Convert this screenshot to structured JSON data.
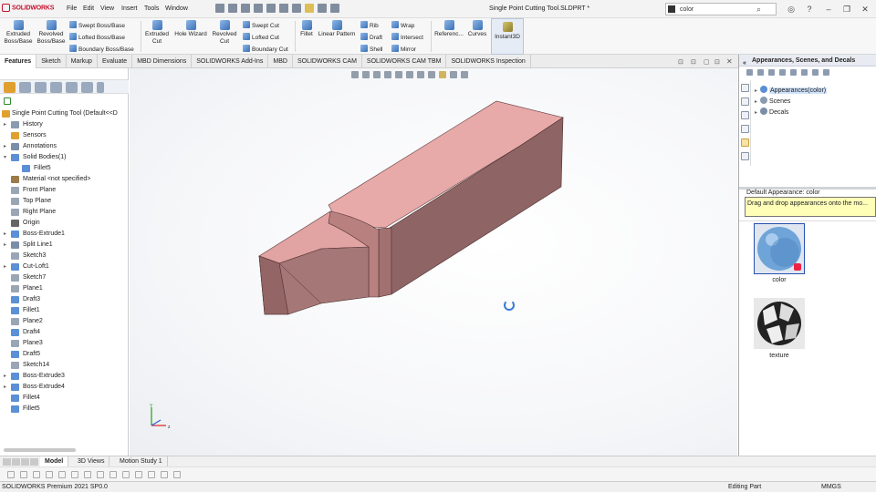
{
  "app": {
    "logo_text": "SOLIDWORKS",
    "menus": [
      "File",
      "Edit",
      "View",
      "Insert",
      "Tools",
      "Window"
    ],
    "document_title": "Single Point Cutting Tool.SLDPRT *",
    "search_value": "color",
    "search_icon": "magnifier-icon",
    "window_buttons": [
      "?",
      "–",
      "❐",
      "✕"
    ]
  },
  "ribbon": {
    "extruded_boss": "Extruded\nBoss/Base",
    "revolved_boss": "Revolved\nBoss/Base",
    "swept_boss": "Swept Boss/Base",
    "lofted_boss": "Lofted Boss/Base",
    "boundary_boss": "Boundary Boss/Base",
    "extruded_cut": "Extruded\nCut",
    "hole_wizard": "Hole Wizard",
    "revolved_cut": "Revolved\nCut",
    "swept_cut": "Swept Cut",
    "lofted_cut": "Lofted Cut",
    "boundary_cut": "Boundary Cut",
    "fillet": "Fillet",
    "linear_pattern": "Linear Pattern",
    "rib": "Rib",
    "draft": "Draft",
    "shell": "Shell",
    "wrap": "Wrap",
    "intersect": "Intersect",
    "mirror": "Mirror",
    "reference": "Referenc...",
    "curves": "Curves",
    "instant3d": "Instant3D"
  },
  "cm_tabs": [
    "Features",
    "Sketch",
    "Markup",
    "Evaluate",
    "MBD Dimensions",
    "SOLIDWORKS Add-Ins",
    "MBD",
    "SOLIDWORKS CAM",
    "SOLIDWORKS CAM TBM",
    "SOLIDWORKS Inspection"
  ],
  "feature_tree": {
    "root": "Single Point Cutting Tool  (Default<<D",
    "items": [
      {
        "label": "History",
        "arrow": "▸",
        "icon_color": "#8a9bb0"
      },
      {
        "label": "Sensors",
        "arrow": "",
        "icon_color": "#e0a030"
      },
      {
        "label": "Annotations",
        "arrow": "▸",
        "icon_color": "#7a8ea8"
      },
      {
        "label": "Solid Bodies(1)",
        "arrow": "▾",
        "icon_color": "#5b8fd6"
      },
      {
        "label": "Fillet5",
        "arrow": "",
        "icon_color": "#5b8fd6",
        "indent": 1
      },
      {
        "label": "Material <not specified>",
        "arrow": "",
        "icon_color": "#9c7a4a"
      },
      {
        "label": "Front Plane",
        "arrow": "",
        "icon_color": "#9aa6b5"
      },
      {
        "label": "Top Plane",
        "arrow": "",
        "icon_color": "#9aa6b5"
      },
      {
        "label": "Right Plane",
        "arrow": "",
        "icon_color": "#9aa6b5"
      },
      {
        "label": "Origin",
        "arrow": "",
        "icon_color": "#666666"
      },
      {
        "label": "Boss-Extrude1",
        "arrow": "▸",
        "icon_color": "#5b8fd6"
      },
      {
        "label": "Split Line1",
        "arrow": "▸",
        "icon_color": "#7a8ea8"
      },
      {
        "label": "Sketch3",
        "arrow": "",
        "icon_color": "#9aa6b5"
      },
      {
        "label": "Cut-Loft1",
        "arrow": "▸",
        "icon_color": "#5b8fd6"
      },
      {
        "label": "Sketch7",
        "arrow": "",
        "icon_color": "#9aa6b5"
      },
      {
        "label": "Plane1",
        "arrow": "",
        "icon_color": "#9aa6b5"
      },
      {
        "label": "Draft3",
        "arrow": "",
        "icon_color": "#5b8fd6"
      },
      {
        "label": "Fillet1",
        "arrow": "",
        "icon_color": "#5b8fd6"
      },
      {
        "label": "Plane2",
        "arrow": "",
        "icon_color": "#9aa6b5"
      },
      {
        "label": "Draft4",
        "arrow": "",
        "icon_color": "#5b8fd6"
      },
      {
        "label": "Plane3",
        "arrow": "",
        "icon_color": "#9aa6b5"
      },
      {
        "label": "Draft5",
        "arrow": "",
        "icon_color": "#5b8fd6"
      },
      {
        "label": "Sketch14",
        "arrow": "",
        "icon_color": "#9aa6b5"
      },
      {
        "label": "Boss-Extrude3",
        "arrow": "▸",
        "icon_color": "#5b8fd6"
      },
      {
        "label": "Boss-Extrude4",
        "arrow": "▸",
        "icon_color": "#5b8fd6"
      },
      {
        "label": "Fillet4",
        "arrow": "",
        "icon_color": "#5b8fd6"
      },
      {
        "label": "Fillet5",
        "arrow": "",
        "icon_color": "#5b8fd6"
      }
    ]
  },
  "bottom_tabs": [
    "Model",
    "3D Views",
    "Motion Study 1"
  ],
  "status": {
    "left": "SOLIDWORKS Premium 2021 SP0.0",
    "mode": "Editing Part",
    "units": "MMGS"
  },
  "taskpane": {
    "title": "Appearances, Scenes, and Decals",
    "tree": [
      {
        "label": "Appearances(color)",
        "selected": true,
        "icon_color": "#5b8fd6"
      },
      {
        "label": "Scenes",
        "selected": false,
        "icon_color": "#8a9bb0"
      },
      {
        "label": "Decals",
        "selected": false,
        "icon_color": "#7a8ea8"
      }
    ],
    "default_appearance": "Default Appearance: color",
    "tooltip": "Drag and drop appearances onto the mo...",
    "swatches": [
      {
        "label": "color"
      },
      {
        "label": "texture"
      }
    ]
  },
  "colors": {
    "model_top": "#e8a9a9",
    "model_side": "#8f6464",
    "model_front": "#a67777",
    "accent": "#c8102e"
  }
}
